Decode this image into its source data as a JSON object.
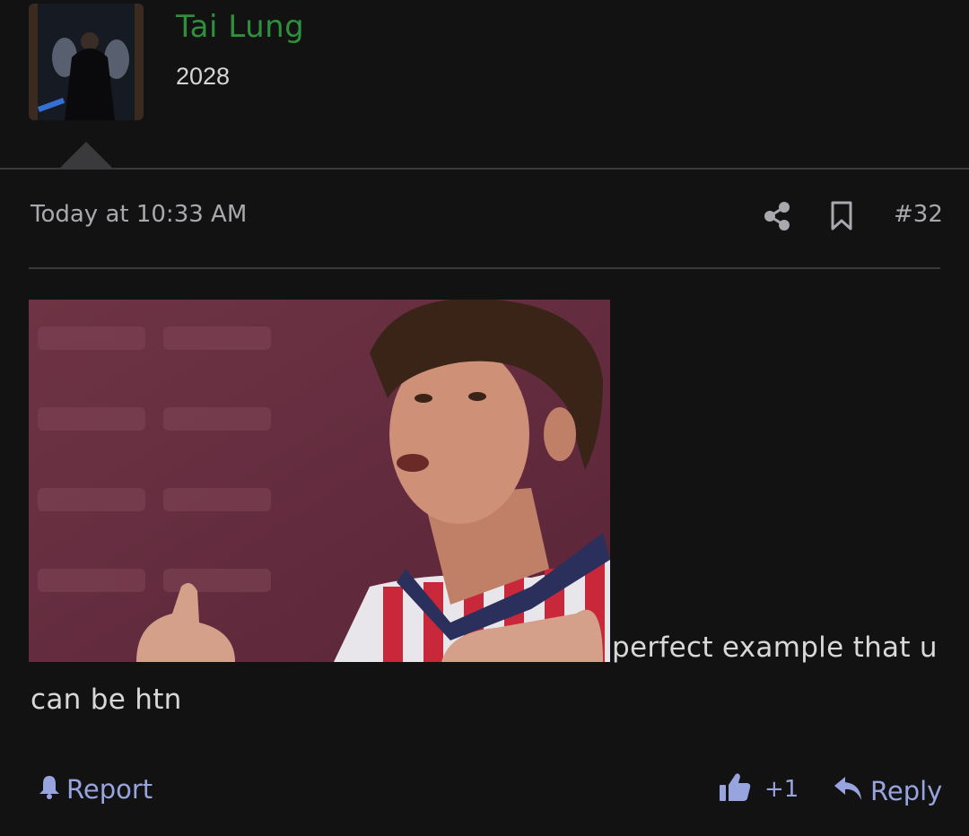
{
  "user": {
    "name": "Tai Lung",
    "year": "2028",
    "name_color": "#2e8f3c"
  },
  "post": {
    "timestamp": "Today at 10:33 AM",
    "number": "#32",
    "message_line1": "perfect example that u",
    "message_line2": "can be htn",
    "icons": {
      "share": "share-icon",
      "bookmark": "bookmark-icon"
    }
  },
  "actions": {
    "report_label": "Report",
    "like_count": "+1",
    "reply_label": "Reply",
    "accent_color": "#98a4dd"
  }
}
